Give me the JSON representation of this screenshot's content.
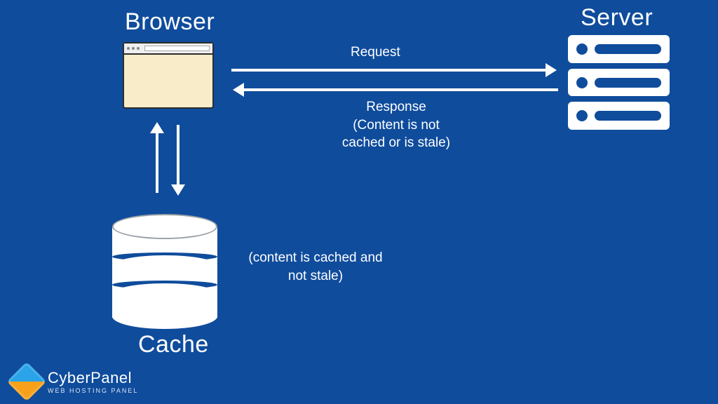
{
  "nodes": {
    "browser": {
      "label": "Browser"
    },
    "server": {
      "label": "Server"
    },
    "cache": {
      "label": "Cache"
    }
  },
  "arrows": {
    "request": {
      "label": "Request"
    },
    "response": {
      "label": "Response",
      "note_line1": "(Content is not",
      "note_line2": "cached or is stale)"
    },
    "cache_note": {
      "line1": "(content is cached and",
      "line2": "not stale)"
    }
  },
  "brand": {
    "name": "CyberPanel",
    "tagline": "WEB HOSTING PANEL"
  }
}
